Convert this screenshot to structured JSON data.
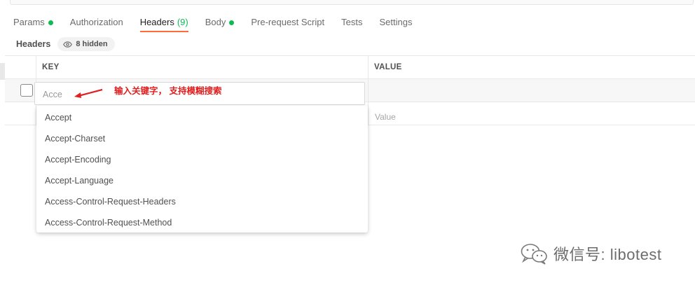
{
  "tabs": [
    {
      "label": "Params",
      "dot": true
    },
    {
      "label": "Authorization",
      "dot": false
    },
    {
      "label": "Headers",
      "count": "(9)",
      "active": true
    },
    {
      "label": "Body",
      "dot": true
    },
    {
      "label": "Pre-request Script",
      "dot": false
    },
    {
      "label": "Tests",
      "dot": false
    },
    {
      "label": "Settings",
      "dot": false
    }
  ],
  "subhead": {
    "title": "Headers",
    "hidden_label": "8 hidden"
  },
  "table": {
    "key_header": "KEY",
    "value_header": "VALUE",
    "key_input_value": "Acce",
    "value_placeholder": "Value"
  },
  "autocomplete": {
    "options": [
      "Accept",
      "Accept-Charset",
      "Accept-Encoding",
      "Accept-Language",
      "Access-Control-Request-Headers",
      "Access-Control-Request-Method"
    ]
  },
  "annotation": {
    "text": "输入关键字， 支持模糊搜索",
    "color": "#e02020"
  },
  "watermark": {
    "text": "微信号: libotest"
  },
  "colors": {
    "accent": "#ff6c37",
    "status_green": "#0cbb52"
  },
  "icons": {
    "hidden": "eye-icon",
    "watermark": "wechat-icon"
  }
}
